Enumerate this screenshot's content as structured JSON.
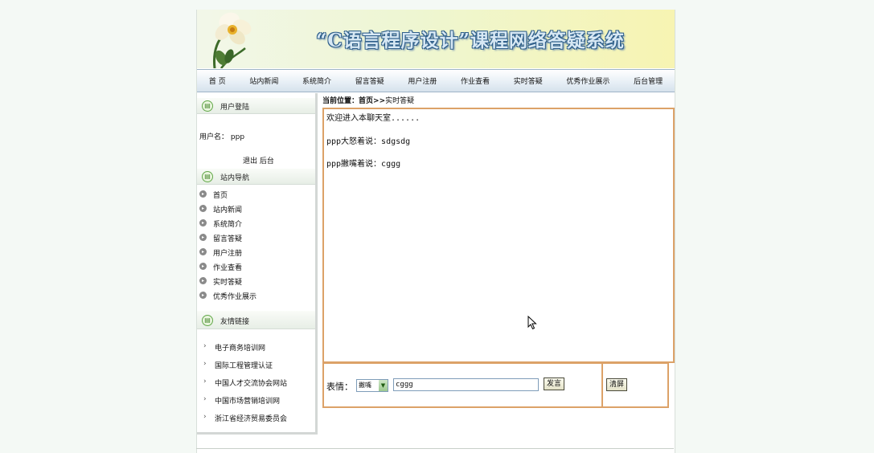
{
  "banner": {
    "title": "“C语言程序设计”课程网络答疑系统"
  },
  "nav": {
    "items": [
      "首 页",
      "站内新闻",
      "系统简介",
      "留言答疑",
      "用户注册",
      "作业查看",
      "实时答疑",
      "优秀作业展示",
      "后台管理"
    ]
  },
  "sidebar": {
    "login_title": "用户登陆",
    "username_label": "用户名：",
    "username_value": "ppp",
    "logout_label": "退出",
    "admin_label": "后台",
    "nav_title": "站内导航",
    "nav_items": [
      "首页",
      "站内新闻",
      "系统简介",
      "留言答疑",
      "用户注册",
      "作业查看",
      "实时答疑",
      "优秀作业展示"
    ],
    "links_title": "友情链接",
    "links": [
      "电子商务培训网",
      "国际工程管理认证",
      "中国人才交流协会网站",
      "中国市场营销培训网",
      "浙江省经济贸易委员会"
    ]
  },
  "breadcrumb": {
    "label": "当前位置：",
    "home": "首页",
    "sep": ">>",
    "current": "实时答疑"
  },
  "chat": {
    "lines": [
      "欢迎进入本聊天室......",
      "ppp大怒着说：sdgsdg",
      "ppp撇嘴着说：cggg"
    ]
  },
  "input": {
    "expression_label": "表情：",
    "expression_value": "撇嘴",
    "message_value": "cggg",
    "send_label": "发言",
    "clear_label": "清屏"
  },
  "colors": {
    "frame": "#dca268",
    "nav_border": "#9fb5c8",
    "title_outline": "#2f5f8a"
  }
}
